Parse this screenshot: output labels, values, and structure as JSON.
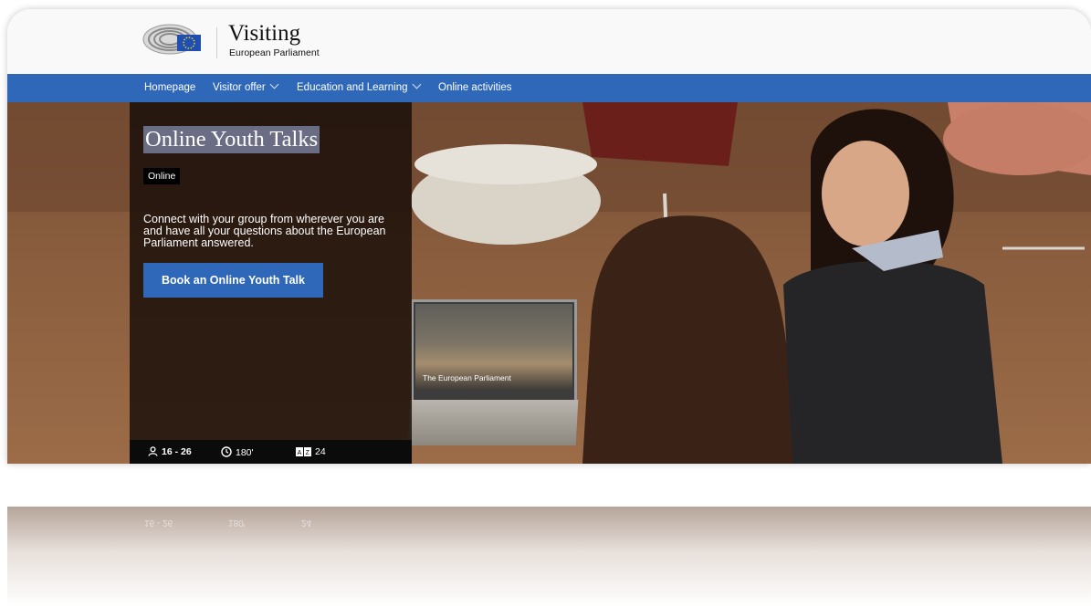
{
  "header": {
    "site_title": "Visiting",
    "site_subtitle": "European Parliament",
    "logo_icon": "parliament-logo-icon"
  },
  "nav": {
    "items": [
      {
        "label": "Homepage",
        "has_dropdown": false
      },
      {
        "label": "Visitor offer",
        "has_dropdown": true
      },
      {
        "label": "Education and Learning",
        "has_dropdown": true
      },
      {
        "label": "Online activities",
        "has_dropdown": false
      }
    ]
  },
  "hero": {
    "title": "Online Youth Talks",
    "badge": "Online",
    "description": "Connect with your group from wherever you are and have all your questions about the European Parliament answered.",
    "cta_label": "Book an Online Youth Talk",
    "laptop_caption": "The European Parliament",
    "stats": {
      "age": "16 - 26",
      "duration": "180'",
      "languages": "24"
    }
  },
  "colors": {
    "nav_bg": "#2f68b8",
    "cta_bg": "#2f68b8",
    "panel_bg": "#190e08"
  }
}
